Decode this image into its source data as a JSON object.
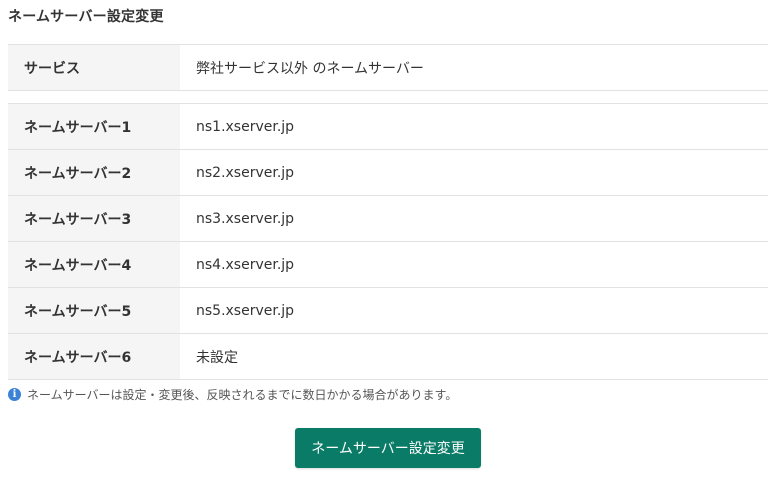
{
  "page": {
    "title": "ネームサーバー設定変更"
  },
  "service": {
    "label": "サービス",
    "value": "弊社サービス以外 のネームサーバー"
  },
  "nameservers": [
    {
      "label": "ネームサーバー1",
      "value": "ns1.xserver.jp"
    },
    {
      "label": "ネームサーバー2",
      "value": "ns2.xserver.jp"
    },
    {
      "label": "ネームサーバー3",
      "value": "ns3.xserver.jp"
    },
    {
      "label": "ネームサーバー4",
      "value": "ns4.xserver.jp"
    },
    {
      "label": "ネームサーバー5",
      "value": "ns5.xserver.jp"
    },
    {
      "label": "ネームサーバー6",
      "value": "未設定"
    }
  ],
  "note": {
    "icon": "info-icon",
    "text": "ネームサーバーは設定・変更後、反映されるまでに数日かかる場合があります。"
  },
  "submit": {
    "label": "ネームサーバー設定変更"
  },
  "colors": {
    "accent": "#0a7b66",
    "info": "#3b82d6",
    "header_bg": "#f5f5f5",
    "border": "#e2e2e2"
  }
}
